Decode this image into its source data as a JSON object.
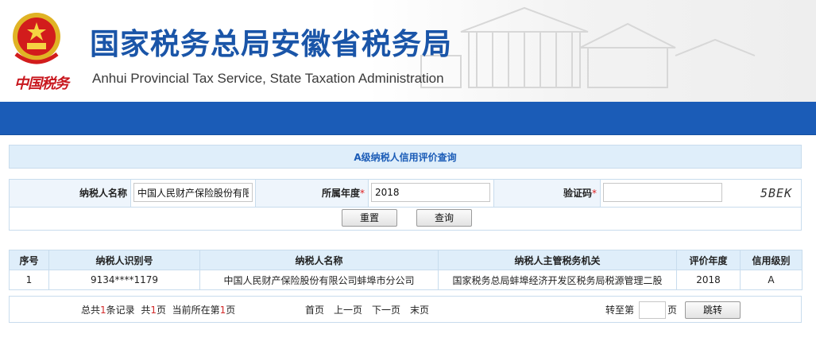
{
  "header": {
    "title_cn": "国家税务总局安徽省税务局",
    "title_en": "Anhui Provincial Tax Service, State Taxation Administration",
    "seal_text": "中国税务",
    "emblem_icon": "national-emblem-icon",
    "brand_color": "#1b5cb7",
    "seal_color": "#c8161d"
  },
  "panel": {
    "title": "A级纳税人信用评价查询"
  },
  "form": {
    "taxpayer_name_label": "纳税人名称",
    "taxpayer_name_value": "中国人民财产保险股份有限公司蚌埠市分公司",
    "year_label": "所属年度",
    "year_value": "2018",
    "captcha_label": "验证码",
    "captcha_value": "",
    "captcha_image_text": "5BEK",
    "required_mark": "*",
    "reset_label": "重置",
    "query_label": "查询"
  },
  "table": {
    "headers": [
      "序号",
      "纳税人识别号",
      "纳税人名称",
      "纳税人主管税务机关",
      "评价年度",
      "信用级别"
    ],
    "rows": [
      [
        "1",
        "9134****1179",
        "中国人民财产保险股份有限公司蚌埠市分公司",
        "国家税务总局蚌埠经济开发区税务局税源管理二股",
        "2018",
        "A"
      ]
    ]
  },
  "pager": {
    "total_prefix": "总共",
    "total_count": "1",
    "total_suffix": "条记录",
    "pages_prefix": "共",
    "pages_count": "1",
    "pages_suffix": "页",
    "current_prefix": "当前所在第",
    "current_page": "1",
    "current_suffix": "页",
    "first": "首页",
    "prev": "上一页",
    "next": "下一页",
    "last": "末页",
    "goto_prefix": "转至第",
    "goto_value": "",
    "goto_suffix": "页",
    "jump_label": "跳转"
  }
}
